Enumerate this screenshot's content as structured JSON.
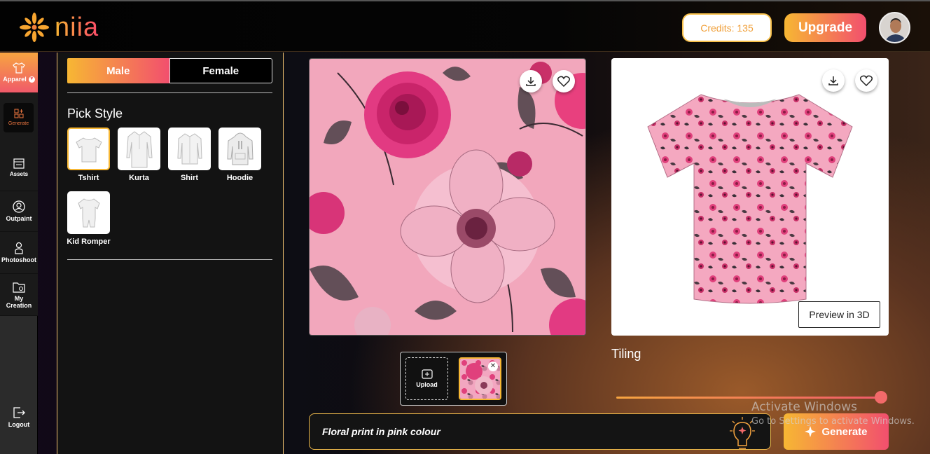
{
  "header": {
    "logo_text": "niia",
    "credits_label": "Credits: 135",
    "upgrade_label": "Upgrade"
  },
  "sidebar": {
    "items": [
      {
        "label": "Apparel",
        "icon": "shirt-icon"
      },
      {
        "label": "Generate",
        "icon": "generate-icon"
      },
      {
        "label": "Assets",
        "icon": "assets-icon"
      },
      {
        "label": "Outpaint",
        "icon": "outpaint-icon"
      },
      {
        "label": "Photoshoot",
        "icon": "photoshoot-icon"
      },
      {
        "label": "My Creation",
        "icon": "folder-icon"
      },
      {
        "label": "Logout",
        "icon": "logout-icon"
      }
    ]
  },
  "style_panel": {
    "gender": {
      "male": "Male",
      "female": "Female",
      "selected": "Male"
    },
    "title": "Pick Style",
    "styles": [
      {
        "label": "Tshirt",
        "selected": true
      },
      {
        "label": "Kurta",
        "selected": false
      },
      {
        "label": "Shirt",
        "selected": false
      },
      {
        "label": "Hoodie",
        "selected": false
      },
      {
        "label": "Kid Romper",
        "selected": false
      }
    ]
  },
  "preview": {
    "preview3d_label": "Preview in 3D",
    "tiling_label": "Tiling",
    "tiling_value": 1.0
  },
  "uploads": {
    "upload_label": "Upload"
  },
  "prompt": {
    "text": "Floral print in pink colour",
    "generate_label": "Generate"
  },
  "watermark": {
    "line1": "Activate Windows",
    "line2": "Go to Settings to activate Windows."
  },
  "colors": {
    "accent_start": "#f7b733",
    "accent_end": "#f24f6e",
    "pattern_pink": "#f0a0b8"
  }
}
